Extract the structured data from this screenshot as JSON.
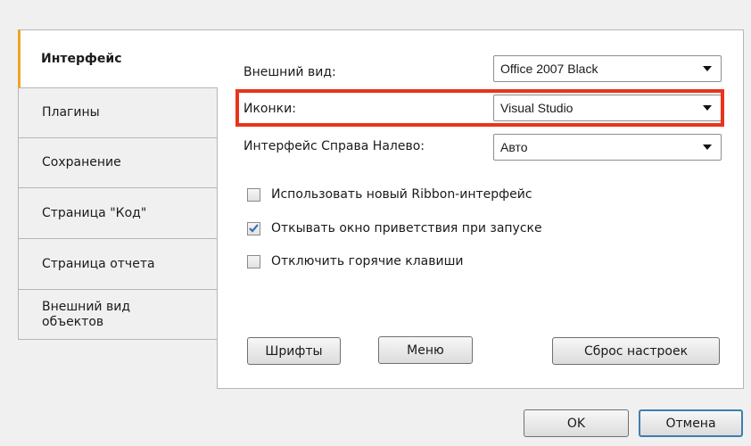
{
  "tabs": [
    {
      "label": "Интерфейс",
      "active": true
    },
    {
      "label": "Плагины"
    },
    {
      "label": "Сохранение"
    },
    {
      "label": "Страница \"Код\""
    },
    {
      "label": "Страница отчета"
    },
    {
      "label": "Внешний вид объектов"
    }
  ],
  "settings": {
    "appearance": {
      "label": "Внешний вид:",
      "value": "Office 2007 Black"
    },
    "icons": {
      "label": "Иконки:",
      "value": "Visual Studio"
    },
    "rtl": {
      "label": "Интерфейс Справа Налево:",
      "value": "Авто"
    }
  },
  "checkboxes": [
    {
      "label": "Использовать новый Ribbon-интерфейс",
      "checked": false
    },
    {
      "label": "Откывать окно приветствия при запуске",
      "checked": true
    },
    {
      "label": "Отключить горячие клавиши",
      "checked": false
    }
  ],
  "panel_buttons": {
    "fonts": "Шрифты",
    "menu": "Меню",
    "reset": "Сброс настроек"
  },
  "footer": {
    "ok": "OK",
    "cancel": "Отмена"
  },
  "colors": {
    "highlight": "#e8341c",
    "active_tab_accent": "#f0a32a",
    "check_mark": "#3b6fb6"
  }
}
